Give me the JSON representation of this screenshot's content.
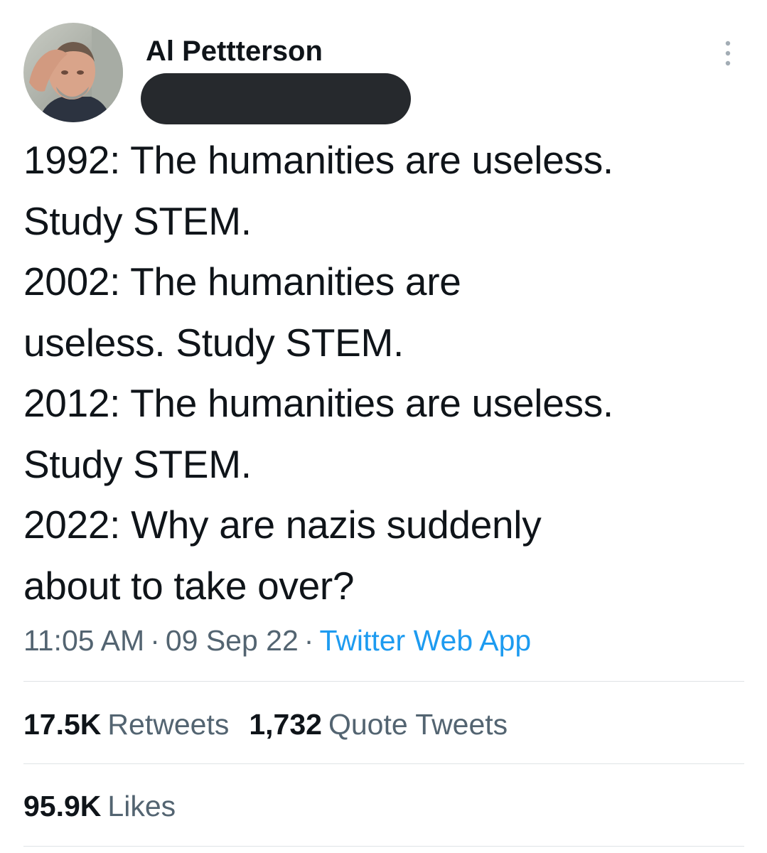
{
  "tweet": {
    "author": {
      "display_name": "Al Pettterson"
    },
    "text_lines": [
      "1992: The humanities are useless.",
      "Study STEM.",
      "2002: The humanities are",
      "useless. Study STEM.",
      "2012: The humanities are useless.",
      "Study STEM.",
      "2022: Why are nazis suddenly",
      "about to take over?"
    ],
    "time": "11:05 AM",
    "date": "09 Sep 22",
    "separator": "·",
    "source": "Twitter Web App",
    "stats": {
      "retweets_count": "17.5K",
      "retweets_label": "Retweets",
      "quotes_count": "1,732",
      "quotes_label": "Quote Tweets",
      "likes_count": "95.9K",
      "likes_label": "Likes"
    }
  },
  "icons": {
    "more": "more-vertical-icon",
    "avatar": "avatar-photo"
  },
  "colors": {
    "text": "#0f1419",
    "secondary": "#536471",
    "link": "#1d9bf0",
    "divider": "#dfe3e6",
    "redaction": "#26292d"
  }
}
